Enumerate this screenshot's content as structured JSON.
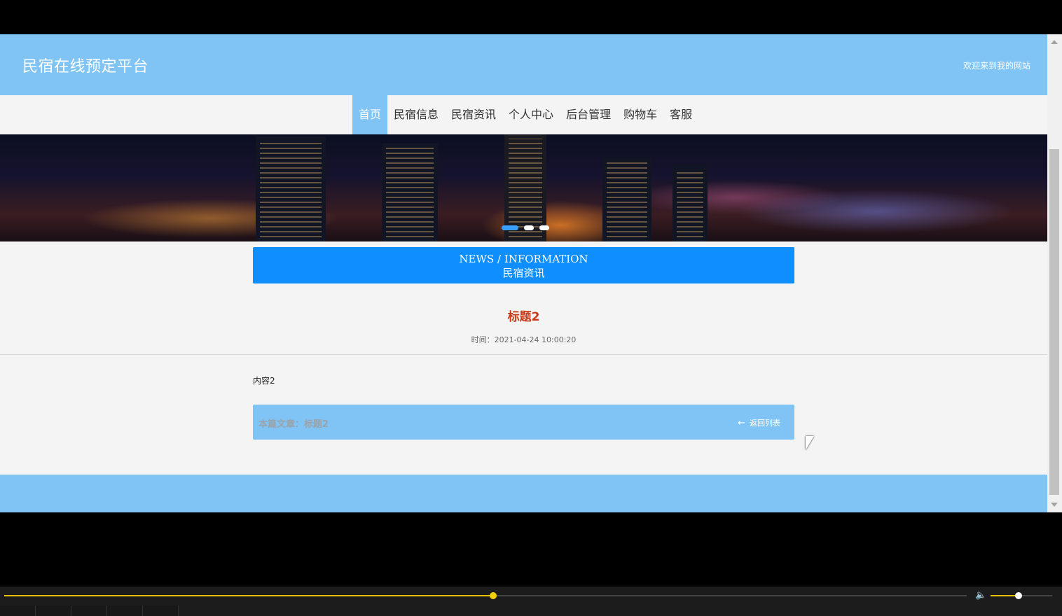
{
  "header": {
    "site_title": "民宿在线预定平台",
    "welcome": "欢迎来到我的网站",
    "bg_color": "#80c4f5"
  },
  "nav": {
    "items": [
      {
        "label": "首页",
        "active": true
      },
      {
        "label": "民宿信息"
      },
      {
        "label": "民宿资讯"
      },
      {
        "label": "个人中心"
      },
      {
        "label": "后台管理"
      },
      {
        "label": "购物车"
      },
      {
        "label": "客服"
      }
    ]
  },
  "banner": {
    "slide_count": 3,
    "active_slide": 1
  },
  "news_section": {
    "title_en": "NEWS / INFORMATION",
    "title_cn": "民宿资讯",
    "color": "#0f8fff"
  },
  "article": {
    "title": "标题2",
    "time": "时间：2021-04-24 10:00:20",
    "content": "内容2",
    "current_label": "本篇文章：标题2",
    "back_label": "返回列表"
  },
  "player": {
    "progress_fraction": 0.508,
    "volume_fraction": 0.45,
    "volume_icon": "speaker-icon",
    "progress_color": "#e8c000"
  }
}
